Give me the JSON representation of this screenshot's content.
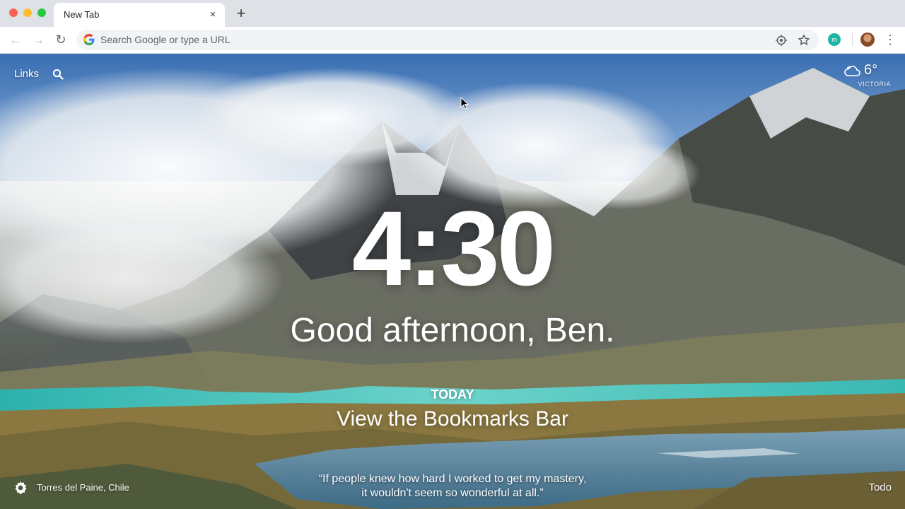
{
  "browser": {
    "tab": {
      "title": "New Tab",
      "close_glyph": "×"
    },
    "new_tab_glyph": "+",
    "nav": {
      "back_glyph": "←",
      "forward_glyph": "→",
      "reload_glyph": "↻"
    },
    "omnibox": {
      "placeholder": "Search Google or type a URL"
    },
    "icons": {
      "google": "google-g-icon",
      "locate": "location-target-icon",
      "bookmark": "star-icon",
      "extension": "momentum-extension-icon",
      "profile": "profile-avatar",
      "menu": "three-dots-menu-icon"
    },
    "extension_label": "m",
    "menu_glyph": "⋮"
  },
  "momentum": {
    "links_label": "Links",
    "weather": {
      "temperature": "6°",
      "location": "VICTORIA",
      "icon": "partly-cloudy-icon"
    },
    "time": "4:30",
    "greeting": "Good afternoon, Ben.",
    "focus": {
      "label": "TODAY",
      "text": "View the Bookmarks Bar"
    },
    "photo_location": "Torres del Paine, Chile",
    "quote": {
      "line1": "“If people knew how hard I worked to get my mastery,",
      "line2": "it wouldn't seem so wonderful at all.”"
    },
    "todo_label": "Todo"
  },
  "colors": {
    "chrome_bg": "#dee1e6",
    "toolbar_bg": "#ffffff",
    "omnibox_bg": "#f1f3f4",
    "extension_accent": "#1fb5a5",
    "lake": "#3fc0b8",
    "sky": "#3f74b8"
  }
}
